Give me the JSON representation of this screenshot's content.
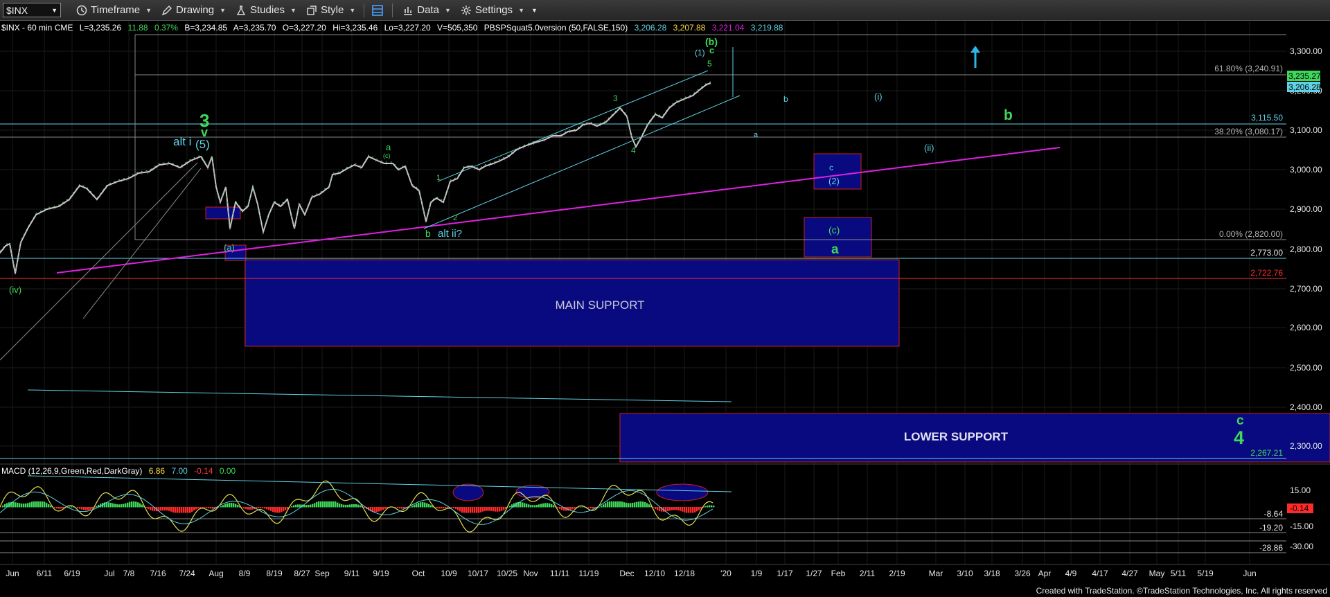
{
  "toolbar": {
    "symbol": "$INX",
    "timeframe": "Timeframe",
    "drawing": "Drawing",
    "studies": "Studies",
    "style": "Style",
    "data": "Data",
    "settings": "Settings"
  },
  "header": {
    "symbol_info": "$INX - 60 min  CME",
    "last": "L=3,235.26",
    "change": "11.88",
    "pct": "0.37%",
    "bid": "B=3,234.85",
    "ask": "A=3,235.70",
    "open": "O=3,227.20",
    "high": "Hi=3,235.46",
    "low": "Lo=3,227.20",
    "volume": "V=505,350",
    "study": "PBSPSquat5.0version (50,FALSE,150)",
    "v1": "3,206.28",
    "v2": "3,207.88",
    "v3": "3,221.04",
    "v4": "3,219.88"
  },
  "macd_header": {
    "name": "MACD (12,26,9,Green,Red,DarkGray)",
    "v1": "6.86",
    "v2": "7.00",
    "v3": "-0.14",
    "v4": "0.00"
  },
  "price_axis": [
    "3,300.00",
    "3,200.00",
    "3,100.00",
    "3,000.00",
    "2,900.00",
    "2,800.00",
    "2,700.00",
    "2,600.00",
    "2,500.00",
    "2,400.00",
    "2,300.00"
  ],
  "price_tags": {
    "last": "3,235.27",
    "prev": "3,206.28"
  },
  "macd_axis": {
    "upper": "15.00",
    "lower": "-30.00",
    "tag": "-0.14"
  },
  "macd_lines": [
    "-8.64",
    "-15.00",
    "-19.20",
    "-28.86"
  ],
  "date_axis": [
    "Jun",
    "6/11",
    "6/19",
    "Jul",
    "7/8",
    "7/16",
    "7/24",
    "Aug",
    "8/9",
    "8/19",
    "8/27",
    "Sep",
    "9/11",
    "9/19",
    "Oct",
    "10/9",
    "10/17",
    "10/25",
    "Nov",
    "11/11",
    "11/19",
    "Dec",
    "12/10",
    "12/18",
    "'20",
    "1/9",
    "1/17",
    "1/27",
    "Feb",
    "2/11",
    "2/19",
    "Mar",
    "3/10",
    "3/18",
    "3/26",
    "Apr",
    "4/9",
    "4/17",
    "4/27",
    "May",
    "5/11",
    "5/19",
    "Jun"
  ],
  "levels": [
    {
      "label": "61.80% (3,240.91)",
      "color": "#b4b4b4"
    },
    {
      "label": "3,115.50",
      "color": "#5fd3e6"
    },
    {
      "label": "38.20% (3,080.17)",
      "color": "#b4b4b4"
    },
    {
      "label": "0.00% (2,820.00)",
      "color": "#b4b4b4"
    },
    {
      "label": "2,773.00",
      "color": "#e8e8e8"
    },
    {
      "label": "2,722.76",
      "color": "#ff2b2b"
    },
    {
      "label": "2,267.21",
      "color": "#3fd85a"
    }
  ],
  "zones": {
    "main": "MAIN SUPPORT",
    "lower": "LOWER SUPPORT"
  },
  "wave_labels": {
    "iv_paren": "(iv)",
    "three": "3",
    "v": "v",
    "alt_i": "alt i",
    "five_paren": "(5)",
    "a_paren": "(a)",
    "a_small": "a",
    "c_small": "(c)",
    "b_small": "b",
    "alt_ii": "alt ii?",
    "one": "1",
    "two": "2",
    "w3": "3",
    "w4": "4",
    "w5": "5",
    "c_top": "c",
    "b_paren_top": "(b)",
    "one_paren": "(1)",
    "proj_a": "a",
    "proj_b": "b",
    "proj_i": "(i)",
    "proj_ii": "(ii)",
    "proj_c": "c",
    "proj_two": "(2)",
    "proj_c_paren": "(c)",
    "proj_big_a": "a",
    "proj_big_b": "b",
    "proj_c4": "c",
    "proj_four": "4"
  },
  "footer": "Created with TradeStation. ©TradeStation Technologies, Inc. All rights reserved",
  "colors": {
    "green": "#3fd85a",
    "cyan": "#5fd3e6",
    "magenta": "#e41ee4",
    "zone_fill": "#0a0a80",
    "zone_border": "#cc2020",
    "grid": "#1e1e1e"
  }
}
